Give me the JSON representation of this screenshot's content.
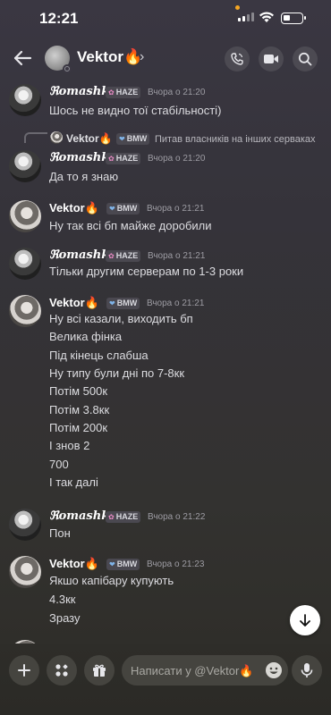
{
  "status_bar": {
    "time": "12:21"
  },
  "header": {
    "title": "Vektor🔥"
  },
  "tags": {
    "haze": "HAZE",
    "bmw": "BMW"
  },
  "messages": [
    {
      "author": "ℜomashka",
      "tag": "HAZE",
      "time": "Вчора о 21:20",
      "lines": [
        "Шось не видно тої стабільності)"
      ]
    },
    {
      "reply": {
        "author": "Vektor🔥",
        "tag": "BMW",
        "text": "Питав власників на інших серваках"
      },
      "author": "ℜomashka",
      "tag": "HAZE",
      "time": "Вчора о 21:20",
      "lines": [
        "Да то я знаю"
      ]
    },
    {
      "author": "Vektor🔥",
      "tag": "BMW",
      "time": "Вчора о 21:21",
      "lines": [
        "Ну так всі бп майже доробили"
      ]
    },
    {
      "author": "ℜomashka",
      "tag": "HAZE",
      "time": "Вчора о 21:21",
      "lines": [
        "Тільки другим серверам по 1-3 роки"
      ]
    },
    {
      "author": "Vektor🔥",
      "tag": "BMW",
      "time": "Вчора о 21:21",
      "lines": [
        "Ну всі казали, виходить бп",
        "Велика фінка",
        "Під кінець слабша",
        "Ну типу були дні по 7-8кк",
        "Потім 500к",
        "Потім 3.8кк",
        "Потім 200к",
        "І знов 2",
        "700",
        "І так далі"
      ]
    },
    {
      "author": "ℜomashka",
      "tag": "HAZE",
      "time": "Вчора о 21:22",
      "lines": [
        "Пон"
      ]
    },
    {
      "author": "Vektor🔥",
      "tag": "BMW",
      "time": "Вчора о 21:23",
      "lines": [
        "Якшо капібару купують",
        "4.3кк",
        "Зразу"
      ]
    }
  ],
  "composer": {
    "placeholder": "Написати у @Vektor🔥"
  },
  "colors": {
    "background_top": "#3a3742",
    "background_bottom": "#2d2c27",
    "tag_bg": "#4a4850",
    "time_text": "#9d9ca3"
  }
}
